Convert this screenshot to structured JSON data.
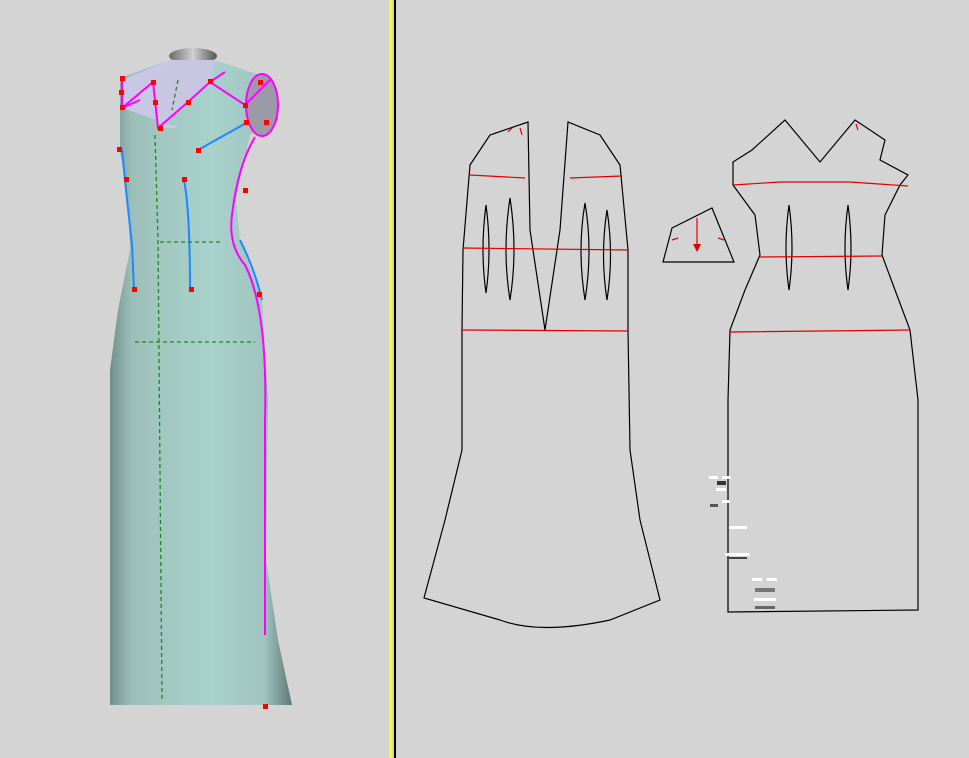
{
  "colors": {
    "background": "#d4d4d4",
    "divider": "#ffff00",
    "divider_dark": "#000000",
    "fabric": "#9ec9c2",
    "seam_magenta": "#ff00ff",
    "dart_blue": "#1e88ff",
    "point_red": "#ff0000",
    "guide_green": "#1a8a1a",
    "pattern_outline": "#000000",
    "pattern_line_red": "#e00000"
  },
  "icons": [
    "control-point-icon",
    "grain-arrow-icon"
  ]
}
